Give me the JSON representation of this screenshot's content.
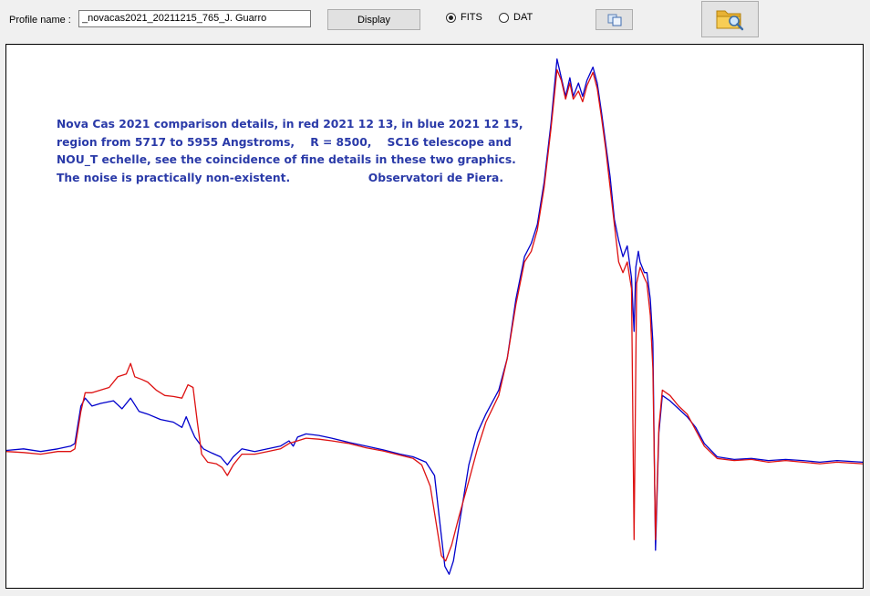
{
  "toolbar": {
    "profile_label": "Profile name :",
    "profile_value": "_novacas2021_20211215_765_J. Guarro",
    "display_label": "Display",
    "format_options": [
      {
        "label": "FITS",
        "selected": true
      },
      {
        "label": "DAT",
        "selected": false
      }
    ],
    "copy_icon": "copy-icon",
    "open_icon": "folder-search-icon"
  },
  "annotation": {
    "lines": [
      "Nova Cas 2021 comparison details, in red 2021 12 13, in blue 2021 12 15,",
      "region from 5717 to 5955 Angstroms,    R = 8500,    SC16 telescope and",
      "NOU_T echelle, see the coincidence of fine details in these two graphics.",
      "The noise is practically non-existent.                    Observatori de Piera."
    ]
  },
  "chart_data": {
    "type": "line",
    "x_range": [
      5717,
      5955
    ],
    "ylim": [
      0,
      1
    ],
    "grid": false,
    "series": [
      {
        "color": "#0000cc",
        "points": [
          [
            0,
            0.247
          ],
          [
            0.02,
            0.25
          ],
          [
            0.04,
            0.245
          ],
          [
            0.06,
            0.25
          ],
          [
            0.075,
            0.255
          ],
          [
            0.08,
            0.26
          ],
          [
            0.087,
            0.33
          ],
          [
            0.092,
            0.345
          ],
          [
            0.1,
            0.33
          ],
          [
            0.11,
            0.335
          ],
          [
            0.125,
            0.34
          ],
          [
            0.135,
            0.325
          ],
          [
            0.145,
            0.345
          ],
          [
            0.155,
            0.32
          ],
          [
            0.165,
            0.315
          ],
          [
            0.18,
            0.305
          ],
          [
            0.195,
            0.3
          ],
          [
            0.205,
            0.29
          ],
          [
            0.21,
            0.31
          ],
          [
            0.215,
            0.29
          ],
          [
            0.22,
            0.272
          ],
          [
            0.23,
            0.25
          ],
          [
            0.24,
            0.242
          ],
          [
            0.25,
            0.235
          ],
          [
            0.258,
            0.22
          ],
          [
            0.265,
            0.235
          ],
          [
            0.275,
            0.25
          ],
          [
            0.29,
            0.245
          ],
          [
            0.305,
            0.25
          ],
          [
            0.32,
            0.255
          ],
          [
            0.33,
            0.265
          ],
          [
            0.335,
            0.255
          ],
          [
            0.34,
            0.272
          ],
          [
            0.35,
            0.278
          ],
          [
            0.365,
            0.275
          ],
          [
            0.38,
            0.27
          ],
          [
            0.4,
            0.262
          ],
          [
            0.42,
            0.255
          ],
          [
            0.44,
            0.248
          ],
          [
            0.46,
            0.24
          ],
          [
            0.475,
            0.235
          ],
          [
            0.49,
            0.225
          ],
          [
            0.5,
            0.2
          ],
          [
            0.507,
            0.1
          ],
          [
            0.512,
            0.03
          ],
          [
            0.517,
            0.015
          ],
          [
            0.522,
            0.04
          ],
          [
            0.53,
            0.12
          ],
          [
            0.54,
            0.22
          ],
          [
            0.55,
            0.28
          ],
          [
            0.56,
            0.315
          ],
          [
            0.575,
            0.36
          ],
          [
            0.585,
            0.42
          ],
          [
            0.595,
            0.53
          ],
          [
            0.605,
            0.61
          ],
          [
            0.613,
            0.635
          ],
          [
            0.62,
            0.67
          ],
          [
            0.628,
            0.75
          ],
          [
            0.636,
            0.86
          ],
          [
            0.643,
            0.98
          ],
          [
            0.648,
            0.945
          ],
          [
            0.653,
            0.91
          ],
          [
            0.658,
            0.945
          ],
          [
            0.662,
            0.91
          ],
          [
            0.668,
            0.935
          ],
          [
            0.673,
            0.91
          ],
          [
            0.678,
            0.94
          ],
          [
            0.685,
            0.965
          ],
          [
            0.69,
            0.935
          ],
          [
            0.695,
            0.88
          ],
          [
            0.7,
            0.82
          ],
          [
            0.705,
            0.76
          ],
          [
            0.71,
            0.68
          ],
          [
            0.715,
            0.64
          ],
          [
            0.72,
            0.61
          ],
          [
            0.725,
            0.63
          ],
          [
            0.73,
            0.57
          ],
          [
            0.733,
            0.47
          ],
          [
            0.735,
            0.59
          ],
          [
            0.738,
            0.62
          ],
          [
            0.74,
            0.6
          ],
          [
            0.745,
            0.58
          ],
          [
            0.748,
            0.58
          ],
          [
            0.752,
            0.53
          ],
          [
            0.755,
            0.45
          ],
          [
            0.758,
            0.06
          ],
          [
            0.762,
            0.28
          ],
          [
            0.766,
            0.35
          ],
          [
            0.775,
            0.34
          ],
          [
            0.785,
            0.325
          ],
          [
            0.795,
            0.31
          ],
          [
            0.805,
            0.29
          ],
          [
            0.815,
            0.26
          ],
          [
            0.83,
            0.235
          ],
          [
            0.85,
            0.23
          ],
          [
            0.87,
            0.232
          ],
          [
            0.89,
            0.228
          ],
          [
            0.91,
            0.23
          ],
          [
            0.93,
            0.228
          ],
          [
            0.95,
            0.225
          ],
          [
            0.97,
            0.228
          ],
          [
            1,
            0.225
          ]
        ]
      },
      {
        "color": "#dd1111",
        "points": [
          [
            0,
            0.245
          ],
          [
            0.02,
            0.243
          ],
          [
            0.04,
            0.24
          ],
          [
            0.06,
            0.245
          ],
          [
            0.075,
            0.245
          ],
          [
            0.08,
            0.25
          ],
          [
            0.087,
            0.32
          ],
          [
            0.092,
            0.355
          ],
          [
            0.1,
            0.355
          ],
          [
            0.11,
            0.36
          ],
          [
            0.12,
            0.365
          ],
          [
            0.13,
            0.385
          ],
          [
            0.14,
            0.39
          ],
          [
            0.145,
            0.41
          ],
          [
            0.15,
            0.385
          ],
          [
            0.158,
            0.38
          ],
          [
            0.165,
            0.375
          ],
          [
            0.175,
            0.36
          ],
          [
            0.185,
            0.35
          ],
          [
            0.195,
            0.348
          ],
          [
            0.205,
            0.345
          ],
          [
            0.212,
            0.37
          ],
          [
            0.218,
            0.365
          ],
          [
            0.223,
            0.3
          ],
          [
            0.228,
            0.24
          ],
          [
            0.235,
            0.225
          ],
          [
            0.245,
            0.222
          ],
          [
            0.252,
            0.215
          ],
          [
            0.258,
            0.2
          ],
          [
            0.265,
            0.22
          ],
          [
            0.275,
            0.24
          ],
          [
            0.29,
            0.24
          ],
          [
            0.305,
            0.245
          ],
          [
            0.32,
            0.25
          ],
          [
            0.33,
            0.26
          ],
          [
            0.34,
            0.265
          ],
          [
            0.35,
            0.27
          ],
          [
            0.365,
            0.268
          ],
          [
            0.38,
            0.265
          ],
          [
            0.4,
            0.26
          ],
          [
            0.42,
            0.252
          ],
          [
            0.44,
            0.246
          ],
          [
            0.46,
            0.238
          ],
          [
            0.475,
            0.232
          ],
          [
            0.485,
            0.22
          ],
          [
            0.495,
            0.18
          ],
          [
            0.503,
            0.1
          ],
          [
            0.508,
            0.05
          ],
          [
            0.513,
            0.04
          ],
          [
            0.52,
            0.07
          ],
          [
            0.528,
            0.12
          ],
          [
            0.54,
            0.19
          ],
          [
            0.55,
            0.25
          ],
          [
            0.56,
            0.3
          ],
          [
            0.575,
            0.35
          ],
          [
            0.585,
            0.42
          ],
          [
            0.595,
            0.52
          ],
          [
            0.605,
            0.6
          ],
          [
            0.613,
            0.62
          ],
          [
            0.62,
            0.66
          ],
          [
            0.628,
            0.74
          ],
          [
            0.636,
            0.85
          ],
          [
            0.643,
            0.96
          ],
          [
            0.648,
            0.94
          ],
          [
            0.653,
            0.905
          ],
          [
            0.658,
            0.935
          ],
          [
            0.662,
            0.905
          ],
          [
            0.668,
            0.92
          ],
          [
            0.673,
            0.9
          ],
          [
            0.678,
            0.93
          ],
          [
            0.685,
            0.955
          ],
          [
            0.69,
            0.925
          ],
          [
            0.695,
            0.87
          ],
          [
            0.7,
            0.81
          ],
          [
            0.705,
            0.74
          ],
          [
            0.71,
            0.67
          ],
          [
            0.715,
            0.6
          ],
          [
            0.72,
            0.58
          ],
          [
            0.725,
            0.6
          ],
          [
            0.73,
            0.55
          ],
          [
            0.733,
            0.08
          ],
          [
            0.736,
            0.56
          ],
          [
            0.74,
            0.59
          ],
          [
            0.745,
            0.57
          ],
          [
            0.748,
            0.56
          ],
          [
            0.752,
            0.5
          ],
          [
            0.755,
            0.4
          ],
          [
            0.758,
            0.08
          ],
          [
            0.762,
            0.29
          ],
          [
            0.766,
            0.36
          ],
          [
            0.775,
            0.35
          ],
          [
            0.785,
            0.33
          ],
          [
            0.795,
            0.315
          ],
          [
            0.805,
            0.285
          ],
          [
            0.815,
            0.255
          ],
          [
            0.83,
            0.232
          ],
          [
            0.85,
            0.228
          ],
          [
            0.87,
            0.23
          ],
          [
            0.89,
            0.225
          ],
          [
            0.91,
            0.228
          ],
          [
            0.93,
            0.225
          ],
          [
            0.95,
            0.222
          ],
          [
            0.97,
            0.225
          ],
          [
            1,
            0.222
          ]
        ]
      }
    ]
  }
}
